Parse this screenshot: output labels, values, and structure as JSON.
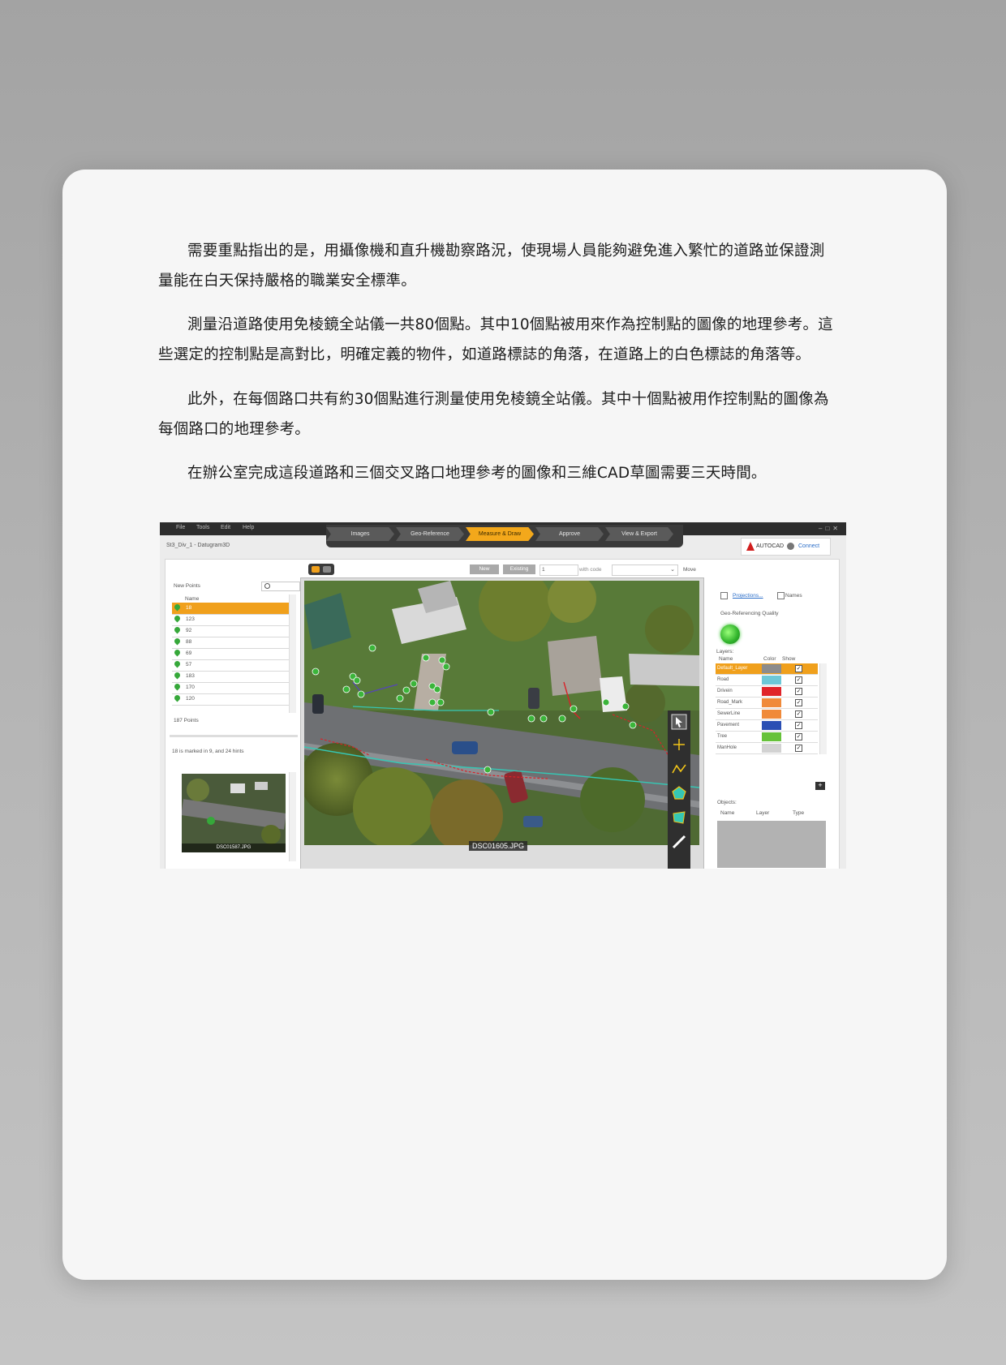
{
  "paragraphs": [
    "需要重點指出的是，用攝像機和直升機勘察路況，使現場人員能夠避免進入繁忙的道路並保證測量能在白天保持嚴格的職業安全標準。",
    "測量沿道路使用免棱鏡全站儀一共80個點。其中10個點被用來作為控制點的圖像的地理參考。這些選定的控制點是高對比，明確定義的物件，如道路標誌的角落，在道路上的白色標誌的角落等。",
    "此外，在每個路口共有約30個點進行測量使用免棱鏡全站儀。其中十個點被用作控制點的圖像為每個路口的地理參考。",
    "在辦公室完成這段道路和三個交叉路口地理參考的圖像和三維CAD草圖需要三天時間。"
  ],
  "app": {
    "menu": [
      "File",
      "Tools",
      "Edit",
      "Help"
    ],
    "workflow_steps": [
      "Images",
      "Geo-Reference",
      "Measure & Draw",
      "Approve",
      "View & Export"
    ],
    "active_step": "Measure & Draw",
    "project_title": "St3_Div_1 - Datugram3D",
    "autocad": {
      "label": "AUTOCAD",
      "connect": "Connect"
    },
    "toolbar": {
      "new": "New",
      "existing": "Existing",
      "value": "1",
      "with_code": "with code",
      "move": "Move"
    },
    "points_panel": {
      "title": "New Points",
      "column": "Name",
      "points": [
        "18",
        "123",
        "92",
        "88",
        "69",
        "57",
        "183",
        "170",
        "120"
      ],
      "selected": "18",
      "count": "187 Points",
      "hint": "18 is marked in 9, and 24 hints",
      "thumbnail_caption": "DSC01587.JPG"
    },
    "image_caption": "DSC01605.JPG",
    "right_panel": {
      "projections": "Projections...",
      "names": "Names",
      "geo_quality": "Geo-Referencing Quality",
      "layers_title": "Layers:",
      "layer_columns": [
        "Name",
        "Color",
        "Show"
      ],
      "layers": [
        {
          "name": "Default_Layer",
          "color": "#8c8c8c",
          "selected": true
        },
        {
          "name": "Road",
          "color": "#6cc8d8",
          "selected": false
        },
        {
          "name": "Drivein",
          "color": "#e0242a",
          "selected": false
        },
        {
          "name": "Road_Mark",
          "color": "#f08a3a",
          "selected": false
        },
        {
          "name": "SewerLine",
          "color": "#f08a3a",
          "selected": false
        },
        {
          "name": "Pavement",
          "color": "#2a4fb4",
          "selected": false
        },
        {
          "name": "Tree",
          "color": "#66c23a",
          "selected": false
        },
        {
          "name": "ManHole",
          "color": "#d2d2d2",
          "selected": false
        }
      ],
      "objects_title": "Objects:",
      "object_columns": [
        "Name",
        "Layer",
        "Type"
      ]
    }
  },
  "colors": {
    "accent": "#f0a01c",
    "marker": "#36a83a",
    "measure_line": "#d8232a",
    "road_line": "#35c7b4"
  }
}
